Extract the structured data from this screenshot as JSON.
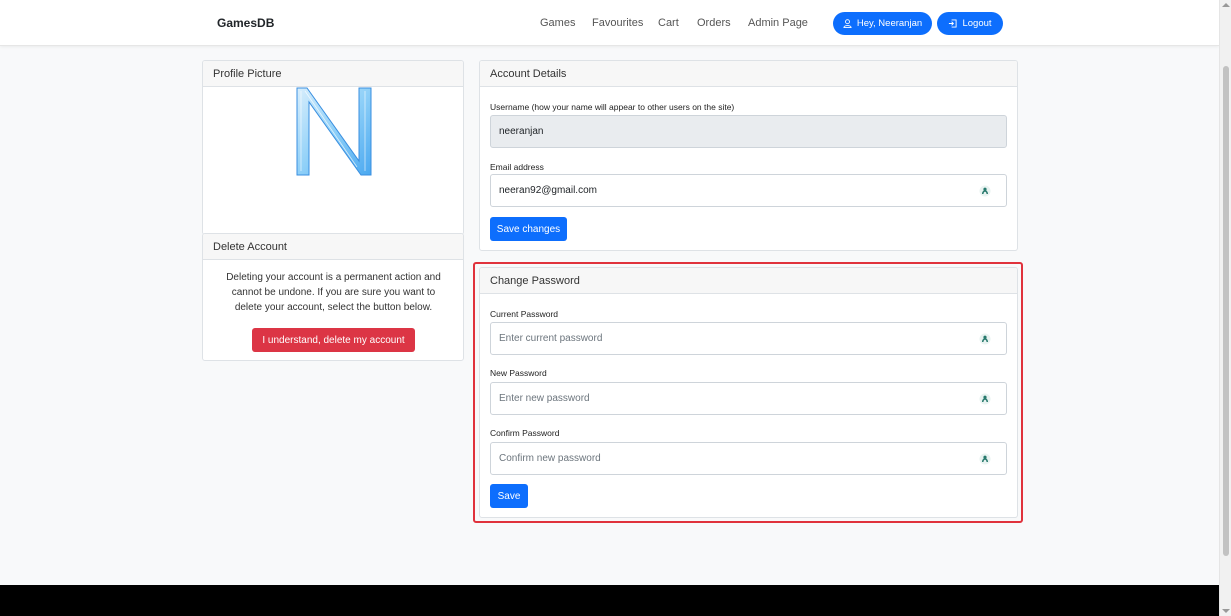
{
  "navbar": {
    "brand": "GamesDB",
    "links": [
      "Games",
      "Favourites",
      "Cart",
      "Orders",
      "Admin Page"
    ],
    "user_button": "Hey, Neeranjan",
    "logout_button": "Logout"
  },
  "profile_card": {
    "title": "Profile Picture",
    "avatar_letter": "N"
  },
  "delete_card": {
    "title": "Delete Account",
    "text": "Deleting your account is a permanent action and cannot be undone. If you are sure you want to delete your account, select the button below.",
    "button": "I understand, delete my account"
  },
  "account_card": {
    "title": "Account Details",
    "username_label": "Username (how your name will appear to other users on the site)",
    "username_value": "neeranjan",
    "email_label": "Email address",
    "email_value": "neeran92@gmail.com",
    "save_button": "Save changes"
  },
  "password_card": {
    "title": "Change Password",
    "current_label": "Current Password",
    "current_placeholder": "Enter current password",
    "new_label": "New Password",
    "new_placeholder": "Enter new password",
    "confirm_label": "Confirm Password",
    "confirm_placeholder": "Confirm new password",
    "save_button": "Save"
  },
  "icons": {
    "user": "person-icon",
    "logout": "logout-icon",
    "autofill": "password-manager-icon"
  },
  "colors": {
    "primary": "#0d6efd",
    "danger": "#dc3545",
    "highlight": "#e0323c"
  }
}
